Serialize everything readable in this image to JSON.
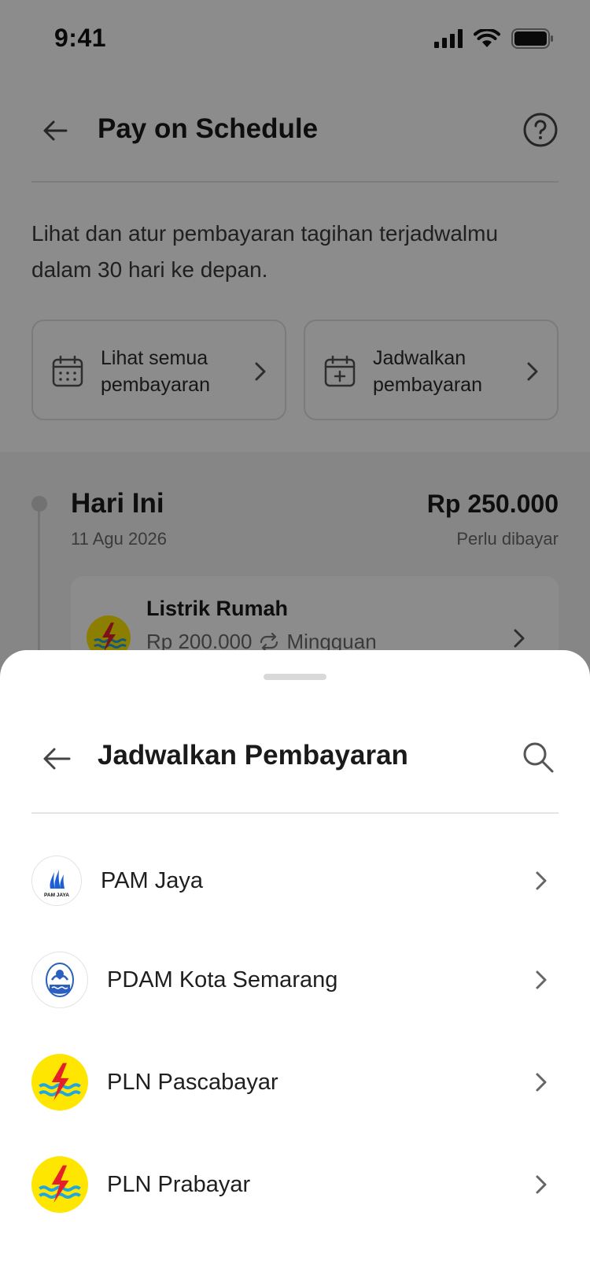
{
  "status_bar": {
    "time": "9:41"
  },
  "header": {
    "title": "Pay on Schedule"
  },
  "intro_text": "Lihat dan atur pembayaran tagihan terjadwalmu dalam 30 hari ke depan.",
  "actions": [
    {
      "label": "Lihat semua\npembayaran",
      "icon": "calendar-icon"
    },
    {
      "label": "Jadwalkan\npembayaran",
      "icon": "calendar-add-icon"
    }
  ],
  "today": {
    "title": "Hari Ini",
    "date": "11 Agu 2026",
    "amount": "Rp 250.000",
    "status": "Perlu dibayar",
    "bill": {
      "name": "Listrik Rumah",
      "amount": "Rp 200.000",
      "frequency": "Mingguan"
    }
  },
  "sheet": {
    "title": "Jadwalkan Pembayaran",
    "items": [
      {
        "label": "PAM Jaya",
        "logo_text": "PAM JAYA"
      },
      {
        "label": "PDAM Kota Semarang"
      },
      {
        "label": "PLN Pascabayar"
      },
      {
        "label": "PLN Prabayar"
      }
    ]
  },
  "colors": {
    "overlay": "#000000",
    "pln_yellow": "#ffe600",
    "pln_red": "#e4202a",
    "pln_blue": "#1ea7e0",
    "pam_blue": "#1d5fd6"
  }
}
